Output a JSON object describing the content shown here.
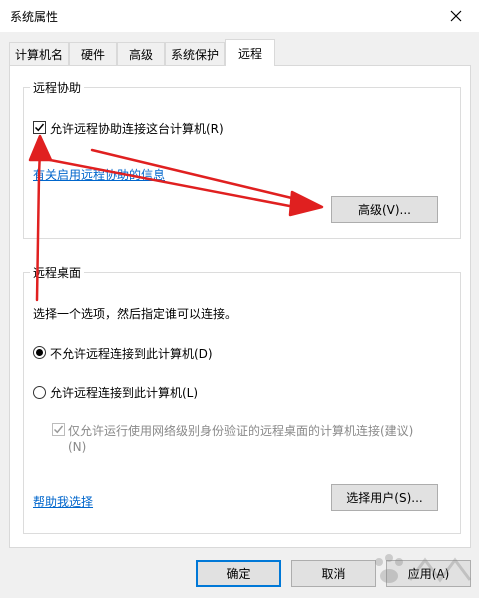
{
  "window": {
    "title": "系统属性"
  },
  "tabs": [
    {
      "label": "计算机名"
    },
    {
      "label": "硬件"
    },
    {
      "label": "高级"
    },
    {
      "label": "系统保护"
    },
    {
      "label": "远程"
    }
  ],
  "remote_assistance": {
    "group_label": "远程协助",
    "allow_checkbox_label": "允许远程协助连接这台计算机(R)",
    "allow_checked": true,
    "info_link": "有关启用远程协助的信息",
    "advanced_button": "高级(V)..."
  },
  "remote_desktop": {
    "group_label": "远程桌面",
    "instruction": "选择一个选项，然后指定谁可以连接。",
    "option_deny": "不允许远程连接到此计算机(D)",
    "option_allow": "允许远程连接到此计算机(L)",
    "selected": "deny",
    "nla_line1": "仅允许运行使用网络级别身份验证的远程桌面的计算机连接(建议)",
    "nla_line2": "(N)",
    "help_link": "帮助我选择",
    "select_users_button": "选择用户(S)..."
  },
  "footer": {
    "ok_button": "确定",
    "cancel_button": "取消",
    "apply_button": "应用(A)"
  },
  "annotation_color": "#e02020"
}
